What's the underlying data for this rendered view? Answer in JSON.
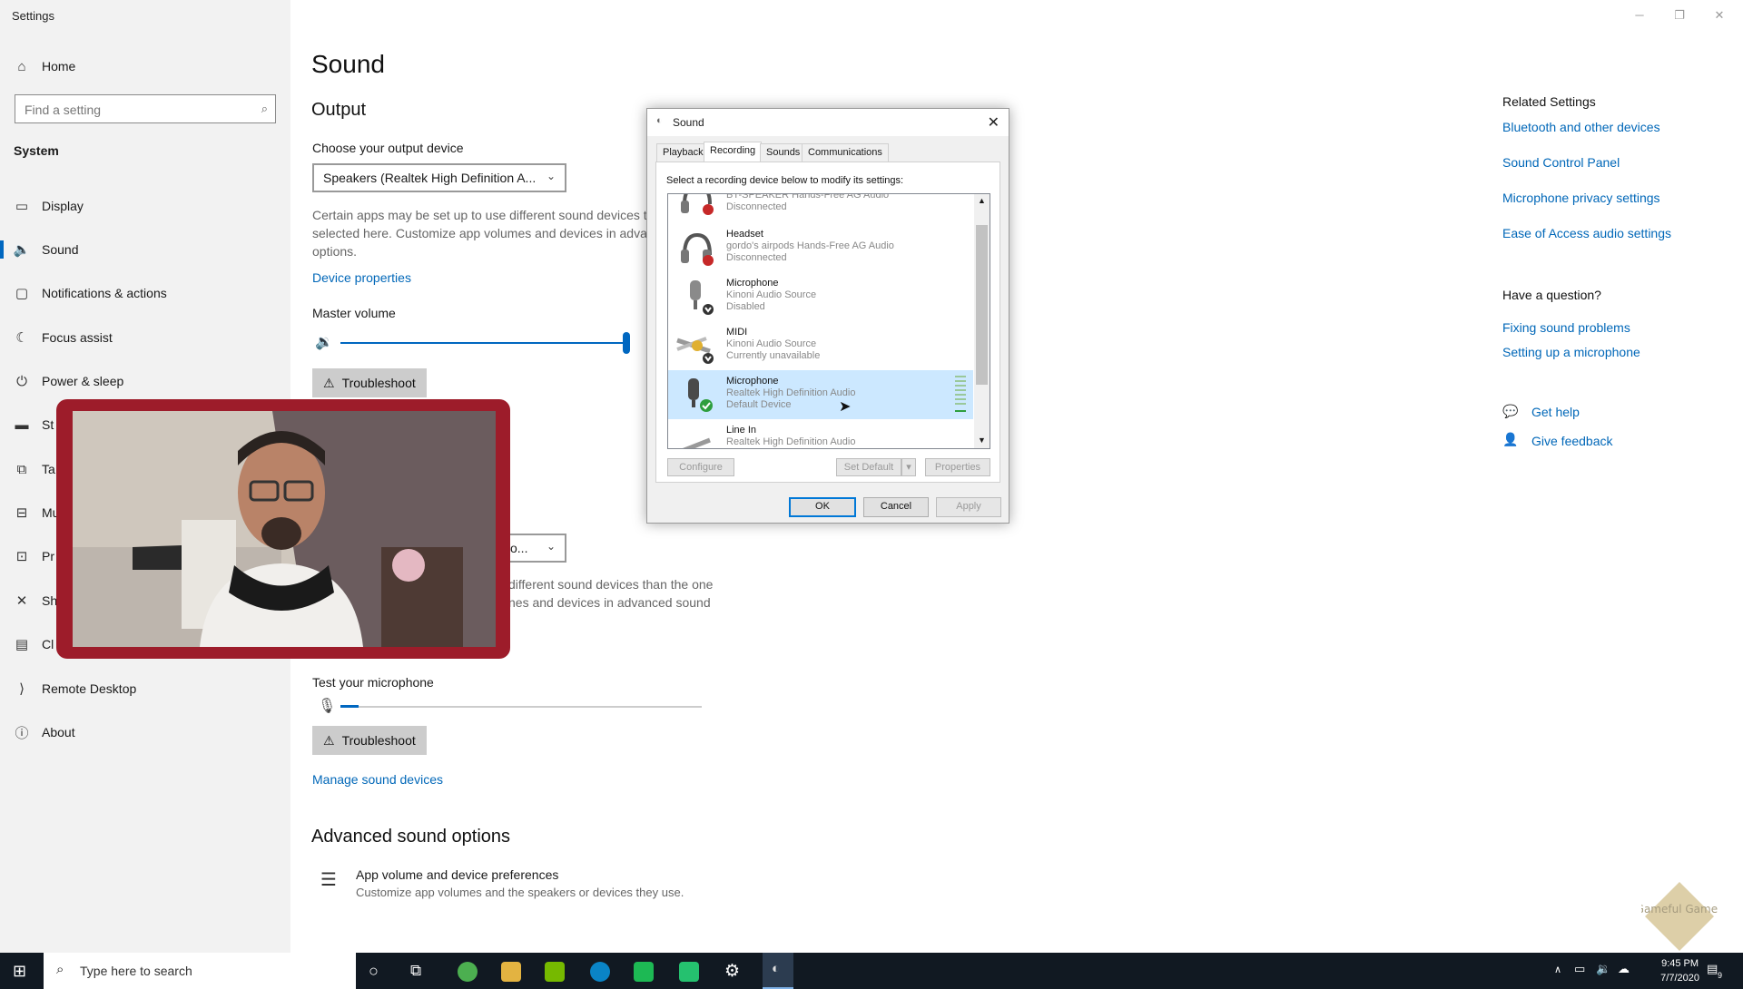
{
  "window": {
    "title": "Settings",
    "minimize": "─",
    "restore": "❐",
    "close": "✕"
  },
  "sidebar": {
    "home": "Home",
    "search_placeholder": "Find a setting",
    "section": "System",
    "items": [
      {
        "label": "Display",
        "icon": "monitor-icon"
      },
      {
        "label": "Sound",
        "icon": "speaker-icon"
      },
      {
        "label": "Notifications & actions",
        "icon": "notifications-icon"
      },
      {
        "label": "Focus assist",
        "icon": "moon-icon"
      },
      {
        "label": "Power & sleep",
        "icon": "power-icon"
      },
      {
        "label": "St",
        "icon": "storage-icon"
      },
      {
        "label": "Ta",
        "icon": "tablet-icon"
      },
      {
        "label": "Mu",
        "icon": "multitasking-icon"
      },
      {
        "label": "Pr",
        "icon": "projecting-icon"
      },
      {
        "label": "Sh",
        "icon": "shared-icon"
      },
      {
        "label": "Cl",
        "icon": "clipboard-icon"
      },
      {
        "label": "Remote Desktop",
        "icon": "remote-desktop-icon"
      },
      {
        "label": "About",
        "icon": "info-icon"
      }
    ]
  },
  "main": {
    "title": "Sound",
    "output": {
      "heading": "Output",
      "choose_label": "Choose your output device",
      "device": "Speakers (Realtek High Definition A...",
      "desc1": "Certain apps may be set up to use different sound devices t",
      "desc2": "selected here. Customize app volumes and devices in advan",
      "desc3": "options.",
      "device_properties": "Device properties",
      "master_volume": "Master volume",
      "volume_level": 1.0,
      "troubleshoot": "Troubleshoot"
    },
    "input": {
      "device_partial": "o...",
      "desc1": "different sound devices than the one",
      "desc2": "nes and devices in advanced sound",
      "test_label": "Test your microphone",
      "mic_level": 0.05,
      "troubleshoot": "Troubleshoot",
      "manage": "Manage sound devices"
    },
    "advanced": {
      "heading": "Advanced sound options",
      "app_volume_title": "App volume and device preferences",
      "app_volume_desc": "Customize app volumes and the speakers or devices they use."
    }
  },
  "related": {
    "heading": "Related Settings",
    "links": [
      "Bluetooth and other devices",
      "Sound Control Panel",
      "Microphone privacy settings",
      "Ease of Access audio settings"
    ],
    "question_heading": "Have a question?",
    "question_links": [
      "Fixing sound problems",
      "Setting up a microphone"
    ],
    "get_help": "Get help",
    "give_feedback": "Give feedback"
  },
  "dialog": {
    "title": "Sound",
    "tabs": [
      "Playback",
      "Recording",
      "Sounds",
      "Communications"
    ],
    "active_tab": "Recording",
    "instruction": "Select a recording device below to modify its settings:",
    "devices": [
      {
        "name": "",
        "sub": "BT-SPEAKER Hands-Free AG Audio",
        "status": "Disconnected",
        "icon": "headset-icon"
      },
      {
        "name": "Headset",
        "sub": "gordo's airpods Hands-Free AG Audio",
        "status": "Disconnected",
        "icon": "headset-icon"
      },
      {
        "name": "Microphone",
        "sub": "Kinoni Audio Source",
        "status": "Disabled",
        "icon": "microphone-icon"
      },
      {
        "name": "MIDI",
        "sub": "Kinoni Audio Source",
        "status": "Currently unavailable",
        "icon": "midi-icon"
      },
      {
        "name": "Microphone",
        "sub": "Realtek High Definition Audio",
        "status": "Default Device",
        "icon": "microphone-icon"
      },
      {
        "name": "Line In",
        "sub": "Realtek High Definition Audio",
        "status": "",
        "icon": "line-in-icon"
      }
    ],
    "configure": "Configure",
    "set_default": "Set Default",
    "properties": "Properties",
    "ok": "OK",
    "cancel": "Cancel",
    "apply": "Apply"
  },
  "taskbar": {
    "search_placeholder": "Type here to search",
    "time": "9:45 PM",
    "date": "7/7/2020",
    "notification_count": "9"
  },
  "watermark": "Gameful Games"
}
